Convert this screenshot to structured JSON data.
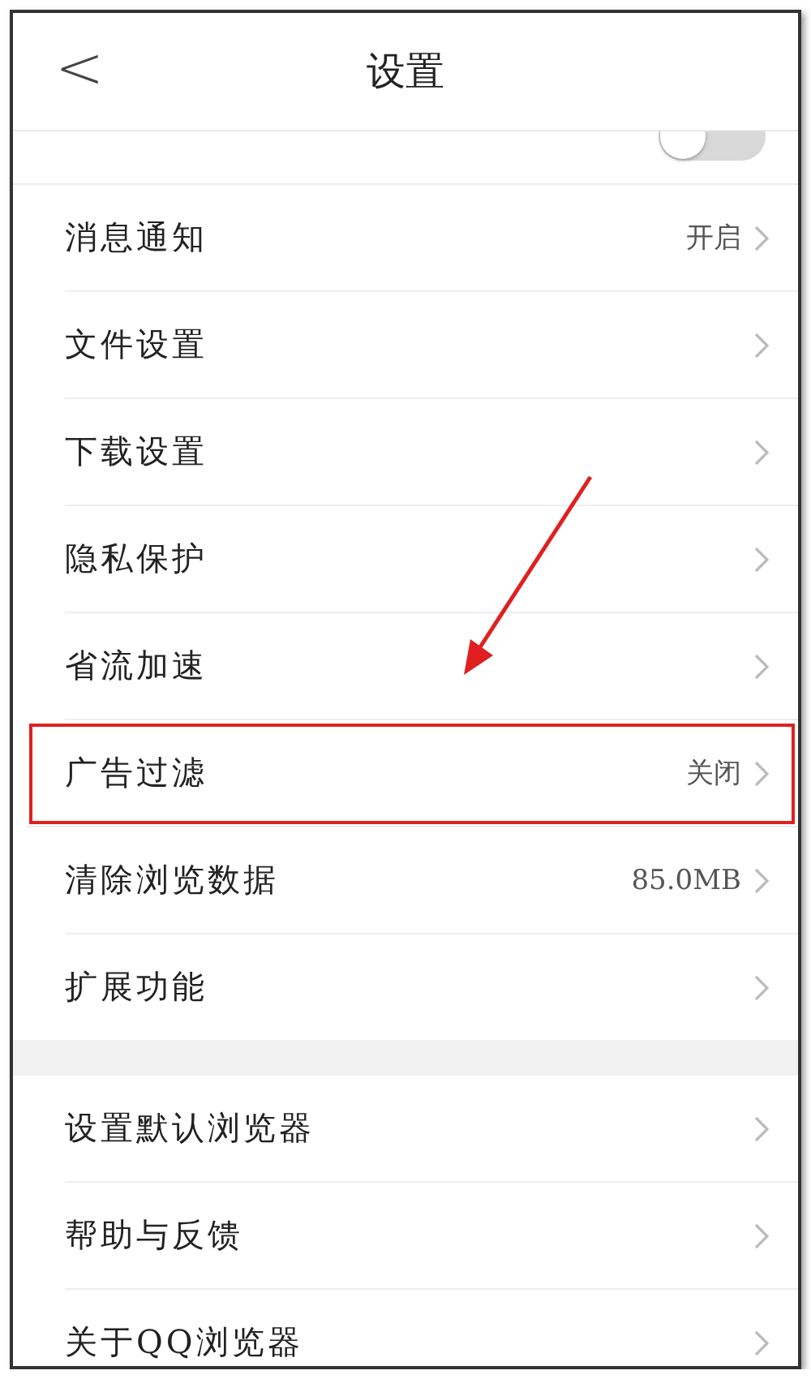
{
  "header": {
    "back": "<",
    "title": "设置"
  },
  "partial_row": {
    "toggle_on": false
  },
  "groups": [
    {
      "items": [
        {
          "label": "消息通知",
          "value": "开启",
          "highlighted": false
        },
        {
          "label": "文件设置",
          "highlighted": false
        },
        {
          "label": "下载设置",
          "highlighted": false
        },
        {
          "label": "隐私保护",
          "highlighted": false
        },
        {
          "label": "省流加速",
          "highlighted": false
        },
        {
          "label": "广告过滤",
          "value": "关闭",
          "highlighted": true
        },
        {
          "label": "清除浏览数据",
          "value": "85.0MB",
          "highlighted": false
        },
        {
          "label": "扩展功能",
          "highlighted": false
        }
      ]
    },
    {
      "items": [
        {
          "label": "设置默认浏览器",
          "highlighted": false
        },
        {
          "label": "帮助与反馈",
          "highlighted": false
        },
        {
          "label": "关于QQ浏览器",
          "highlighted": false
        }
      ]
    }
  ]
}
